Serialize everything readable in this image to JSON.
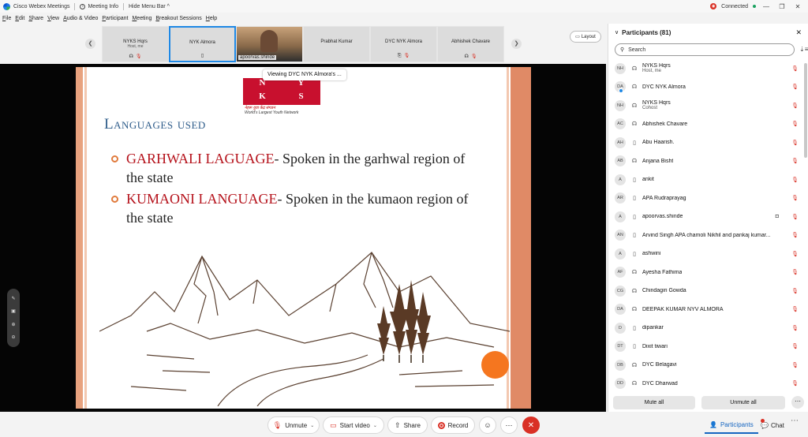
{
  "titlebar": {
    "app_name": "Cisco Webex Meetings",
    "meeting_info": "Meeting Info",
    "hide_menu": "Hide Menu Bar ^",
    "status": "Connected",
    "min": "—",
    "restore": "❐",
    "close": "✕"
  },
  "menu": [
    "File",
    "Edit",
    "Share",
    "View",
    "Audio & Video",
    "Participant",
    "Meeting",
    "Breakout Sessions",
    "Help"
  ],
  "thumbnails": [
    {
      "name": "NYKS Hqrs",
      "sub": "Host, me"
    },
    {
      "name": "NYK Almora",
      "sub": ""
    },
    {
      "name": "apoorvas.shinde",
      "sub": ""
    },
    {
      "name": "Prabhat Kumar",
      "sub": ""
    },
    {
      "name": "DYC NYK Almora",
      "sub": ""
    },
    {
      "name": "Abhishek Chavare",
      "sub": ""
    }
  ],
  "layout_label": "Layout",
  "viewing_tip": "Viewing DYC NYK Almora's ...",
  "slide": {
    "logo_letters": [
      "N",
      "Y",
      "K",
      "S"
    ],
    "logo_hindi": "नेहरू युवा केंद्र संगठन",
    "logo_tagline": "World's Largest Youth Network",
    "title": "Languages used",
    "bullets": [
      {
        "highlight": "GARHWALI LAGUAGE",
        "rest": "- Spoken in the garhwal region of the state"
      },
      {
        "highlight": "KUMAONI LANGUAGE",
        "rest": "- Spoken in the kumaon region of the state"
      }
    ]
  },
  "controls": {
    "unmute": "Unmute",
    "start_video": "Start video",
    "share": "Share",
    "record": "Record",
    "participants": "Participants",
    "chat": "Chat"
  },
  "panel": {
    "title": "Participants (81)",
    "search_placeholder": "Search",
    "mute_all": "Mute all",
    "unmute_all": "Unmute all",
    "participants": [
      {
        "initials": "NH",
        "name": "NYKS Hqrs",
        "sub": "Host, me",
        "device": "headset",
        "video": false,
        "ring": false
      },
      {
        "initials": "DA",
        "name": "DYC NYK Almora",
        "sub": "",
        "device": "headset",
        "video": false,
        "ring": true
      },
      {
        "initials": "NH",
        "name": "NYKS Hqrs",
        "sub": "Cohost",
        "device": "headset",
        "video": false,
        "ring": false
      },
      {
        "initials": "AC",
        "name": "Abhishek Chavare",
        "sub": "",
        "device": "headset",
        "video": false,
        "ring": false
      },
      {
        "initials": "AH",
        "name": "Abu Haarish.",
        "sub": "",
        "device": "phone",
        "video": false,
        "ring": false
      },
      {
        "initials": "AB",
        "name": "Anjana Bisht",
        "sub": "",
        "device": "headset",
        "video": false,
        "ring": false
      },
      {
        "initials": "A",
        "name": "ankit",
        "sub": "",
        "device": "phone",
        "video": false,
        "ring": false
      },
      {
        "initials": "AR",
        "name": "APA Rudraprayag",
        "sub": "",
        "device": "phone",
        "video": false,
        "ring": false
      },
      {
        "initials": "A",
        "name": "apoorvas.shinde",
        "sub": "",
        "device": "phone",
        "video": true,
        "ring": false
      },
      {
        "initials": "AN",
        "name": "Arvind Singh APA chamoli Nikhil and pankaj kumar...",
        "sub": "",
        "device": "phone",
        "video": false,
        "ring": false
      },
      {
        "initials": "A",
        "name": "ashwini",
        "sub": "",
        "device": "phone",
        "video": false,
        "ring": false
      },
      {
        "initials": "AF",
        "name": "Ayesha Fathima",
        "sub": "",
        "device": "headset",
        "video": false,
        "ring": false
      },
      {
        "initials": "CG",
        "name": "Chindagiri Gowda",
        "sub": "",
        "device": "headset",
        "video": false,
        "ring": false
      },
      {
        "initials": "DA",
        "name": "DEEPAK KUMAR NYV ALMORA",
        "sub": "",
        "device": "headset",
        "video": false,
        "ring": false
      },
      {
        "initials": "D",
        "name": "dipankar",
        "sub": "",
        "device": "phone",
        "video": false,
        "ring": false
      },
      {
        "initials": "DT",
        "name": "Dixit tiwari",
        "sub": "",
        "device": "phone",
        "video": false,
        "ring": false
      },
      {
        "initials": "DB",
        "name": "DYC Belagavi",
        "sub": "",
        "device": "headset",
        "video": false,
        "ring": false
      },
      {
        "initials": "DD",
        "name": "DYC Dharwad",
        "sub": "",
        "device": "headset",
        "video": false,
        "ring": false
      }
    ]
  },
  "colors": {
    "accent": "#1e88e5",
    "mute_red": "#d93025",
    "slide_title": "#2e5c8a",
    "slide_highlight": "#b5121b",
    "slide_orange": "#f5761f"
  }
}
